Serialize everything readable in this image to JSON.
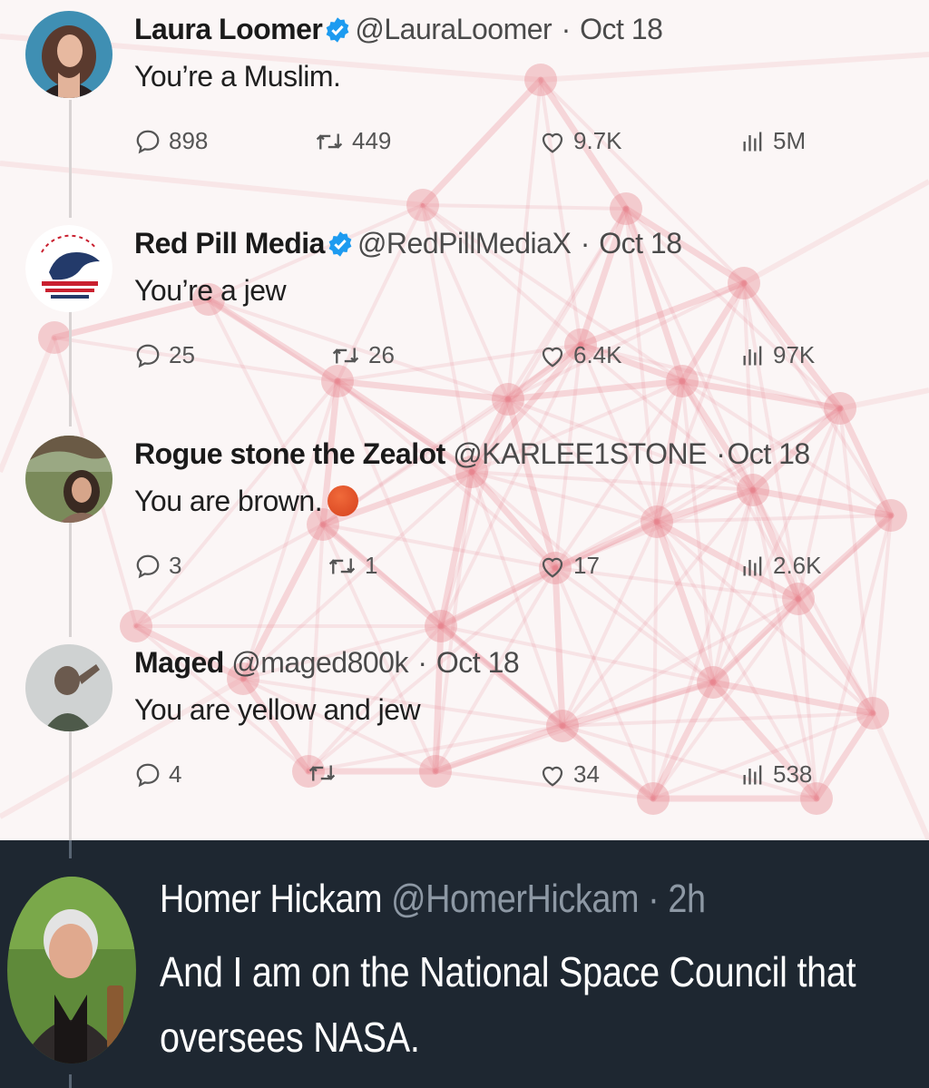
{
  "thread": [
    {
      "name": "Laura Loomer",
      "verified": true,
      "handle": "@LauraLoomer",
      "separator": "·",
      "date": "Oct 18",
      "text": "You’re a Muslim.",
      "replies": "898",
      "reposts": "449",
      "likes": "9.7K",
      "views": "5M",
      "avatar_icon": "woman-portrait-avatar"
    },
    {
      "name": "Red Pill Media",
      "verified": true,
      "handle": "@RedPillMediaX",
      "separator": "·",
      "date": "Oct 18",
      "text": "You’re a jew",
      "replies": "25",
      "reposts": "26",
      "likes": "6.4K",
      "views": "97K",
      "avatar_icon": "eagle-flag-logo-avatar"
    },
    {
      "name": "Rogue stone the Zealot",
      "verified": false,
      "handle": "@KARLEE1STONE",
      "separator": "·",
      "date": "Oct 18",
      "text": "You are brown.",
      "emoji": "red-circle-emoji",
      "replies": "3",
      "reposts": "1",
      "likes": "17",
      "views": "2.6K",
      "avatar_icon": "woman-outdoors-avatar"
    },
    {
      "name": "Maged",
      "verified": false,
      "handle": "@maged800k",
      "separator": "·",
      "date": "Oct 18",
      "text": "You are yellow and jew",
      "replies": "4",
      "reposts": "",
      "likes": "34",
      "views": "538",
      "avatar_icon": "man-saluting-avatar"
    }
  ],
  "reply": {
    "name": "Homer Hickam",
    "handle": "@HomerHickam",
    "separator": "·",
    "time": "2h",
    "text_line1": "And I am on the National Space Council that",
    "text_line2": "oversees NASA.",
    "avatar_icon": "white-haired-man-avatar"
  },
  "colors": {
    "network_accent": "#e8858f",
    "dark_background": "#1e2731",
    "verified_blue": "#1d9bf0",
    "icon_gray": "#555555"
  }
}
